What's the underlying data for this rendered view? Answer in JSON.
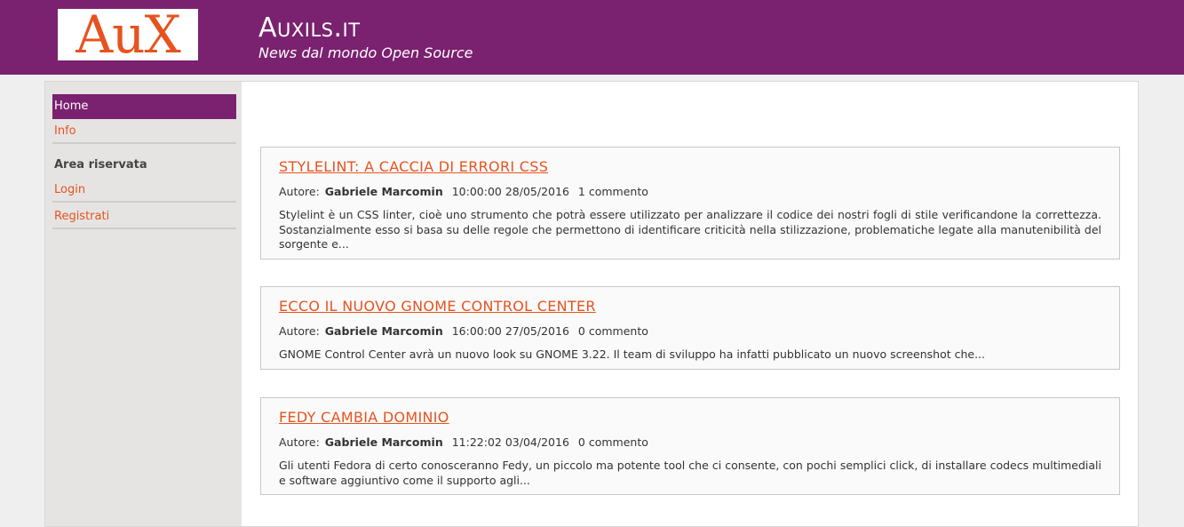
{
  "header": {
    "logo_text": "AuX",
    "site_title": "Auxils.it",
    "site_subtitle": "News dal mondo Open Source"
  },
  "sidebar": {
    "home": "Home",
    "info": "Info",
    "reserved_heading": "Area riservata",
    "login": "Login",
    "register": "Registrati"
  },
  "posts": [
    {
      "title": "STYLELINT: A CACCIA DI ERRORI CSS",
      "author_label": "Autore:",
      "author": "Gabriele Marcomin",
      "datetime": "10:00:00 28/05/2016",
      "comments": "1 commento",
      "excerpt": "Stylelint è un CSS linter, cioè uno strumento che potrà essere utilizzato per analizzare il codice dei nostri fogli di stile verificandone la correttezza. Sostanzialmente esso si basa su delle regole che permettono di identificare criticità nella stilizzazione, problematiche legate alla manutenibilità del sorgente e..."
    },
    {
      "title": "ECCO IL NUOVO GNOME CONTROL CENTER",
      "author_label": "Autore:",
      "author": "Gabriele Marcomin",
      "datetime": "16:00:00 27/05/2016",
      "comments": "0 commento",
      "excerpt": "GNOME Control Center avrà un nuovo look su GNOME 3.22. Il team di sviluppo ha infatti pubblicato un nuovo screenshot che..."
    },
    {
      "title": "FEDY CAMBIA DOMINIO",
      "author_label": "Autore:",
      "author": "Gabriele Marcomin",
      "datetime": "11:22:02 03/04/2016",
      "comments": "0 commento",
      "excerpt": "Gli utenti Fedora di certo conosceranno Fedy, un piccolo ma potente tool che ci consente, con pochi semplici click, di installare codecs multimediali e software aggiuntivo come il supporto agli..."
    }
  ],
  "colors": {
    "brand": "#7a216f",
    "accent": "#e6531f"
  }
}
